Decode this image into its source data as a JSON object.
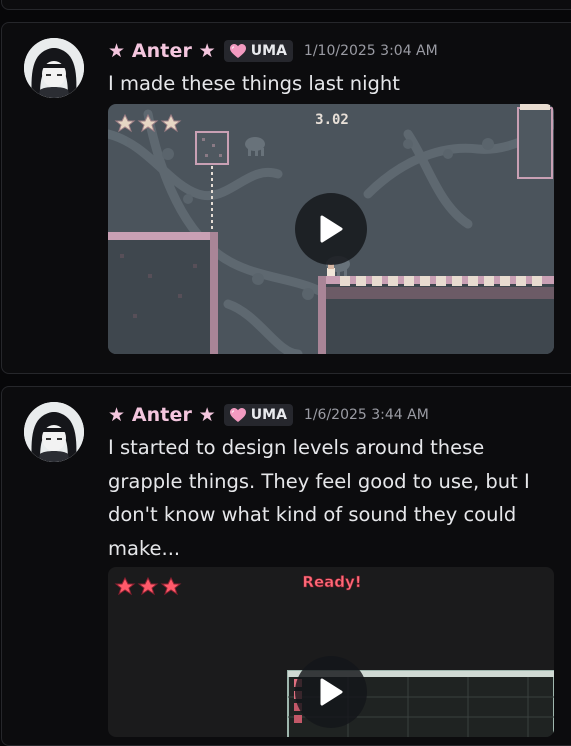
{
  "messages": [
    {
      "author": "★ Anter ★",
      "tag": "UMA",
      "timestamp": "1/10/2025 3:04 AM",
      "lines": [
        "I made these things last night"
      ],
      "video": {
        "hud_timer": "3.02"
      }
    },
    {
      "author": "★ Anter ★",
      "tag": "UMA",
      "timestamp": "1/6/2025 3:44 AM",
      "lines": [
        "I started to design levels around these",
        "grapple things. They feel good to use, but I",
        "don't know what kind of sound they could",
        "make..."
      ],
      "video": {
        "hud_text": "Ready!"
      }
    }
  ],
  "colors": {
    "author": "#f4c6de",
    "tag_bg": "#26272d",
    "heart": "#f29ac0",
    "timestamp": "#9a9ba3",
    "game_bg": "#4b545c",
    "tile_pink": "#c9a0b4",
    "hud_red": "#ff5a6a"
  },
  "icons": [
    "heart-icon",
    "play-icon"
  ]
}
